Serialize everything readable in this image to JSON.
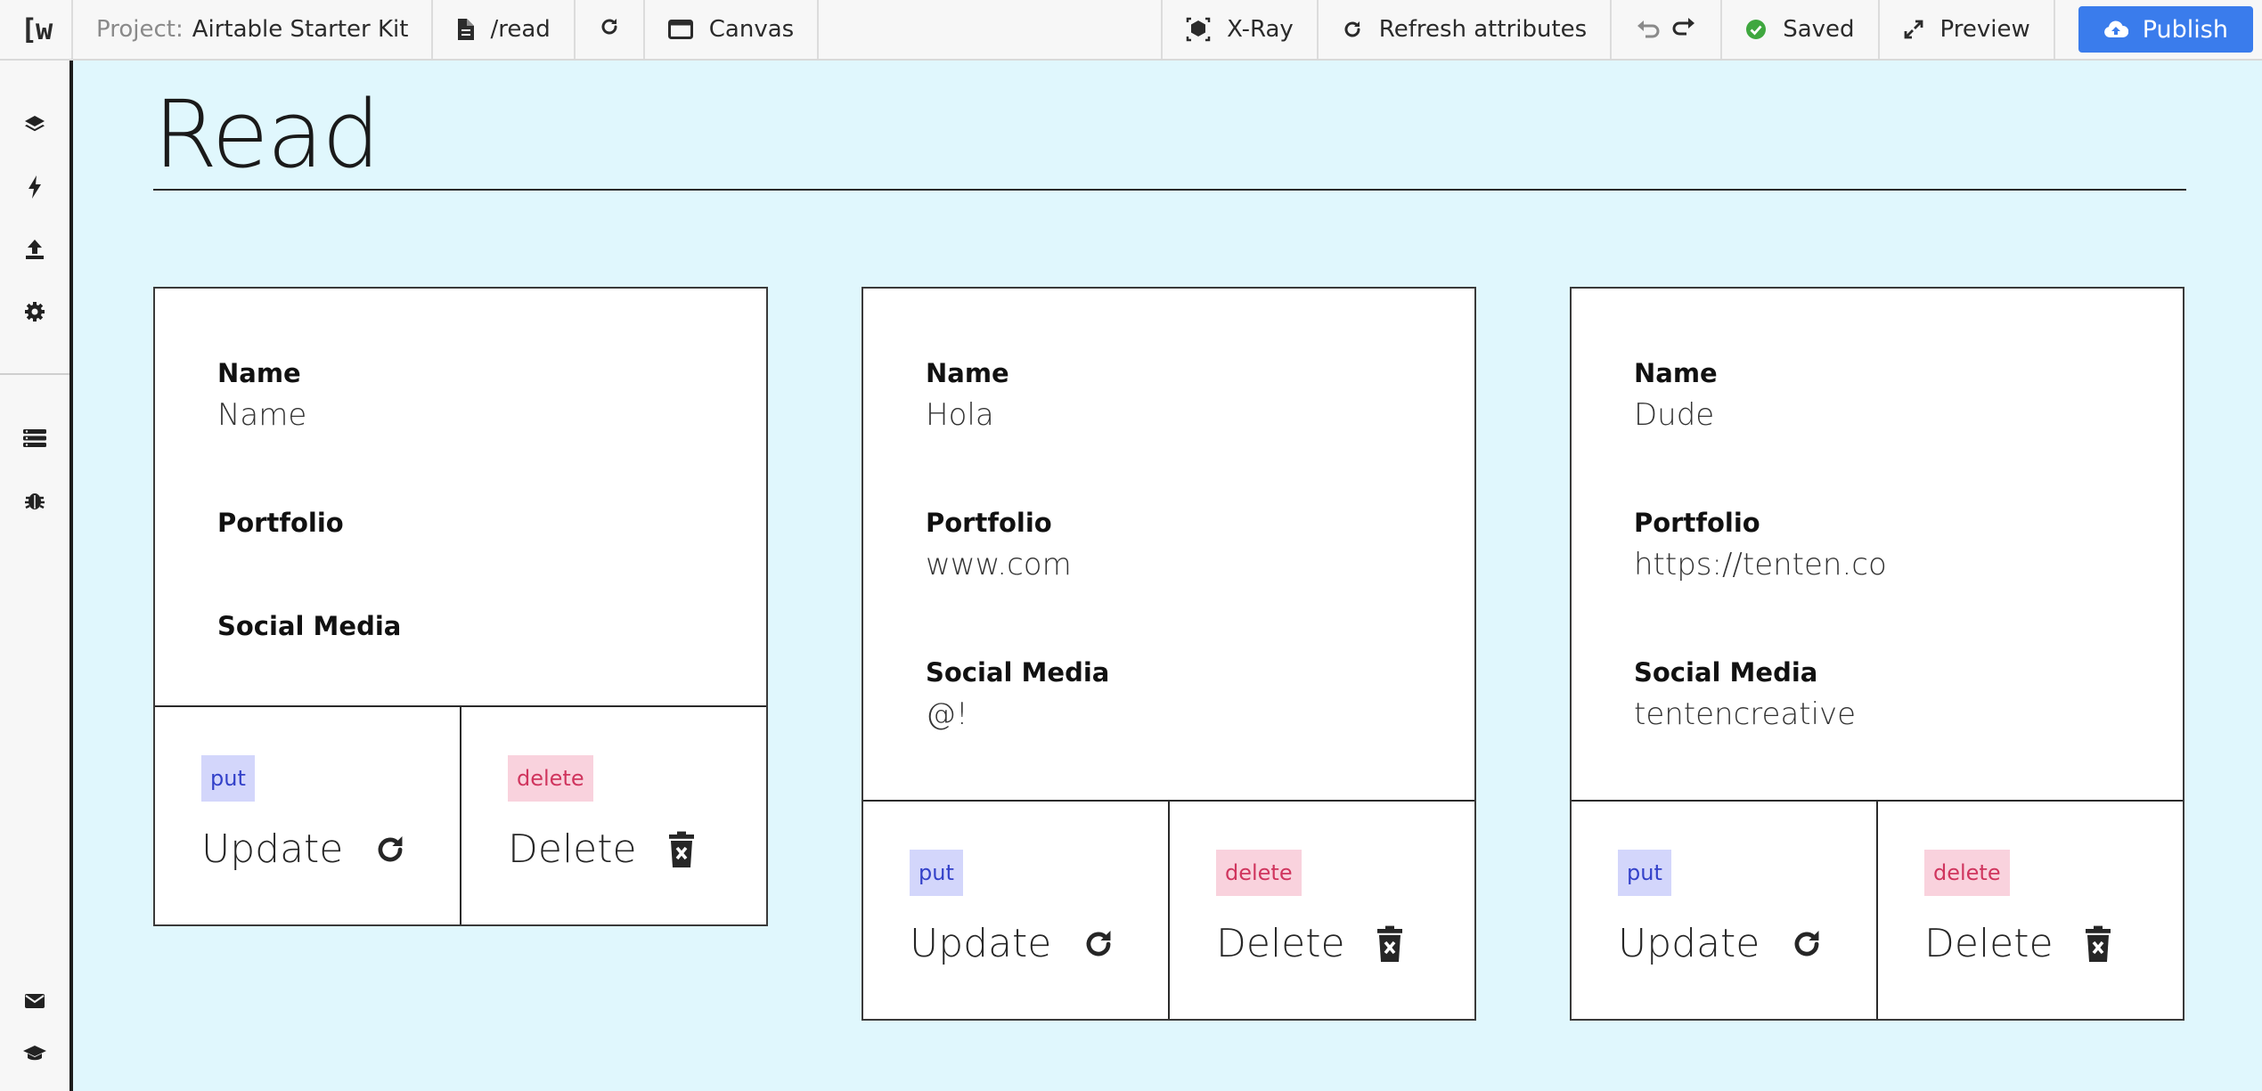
{
  "toolbar": {
    "logo": "[w",
    "project_key": "Project:",
    "project_name": "Airtable Starter Kit",
    "page_path": "/read",
    "canvas_label": "Canvas",
    "xray_label": "X-Ray",
    "refresh_label": "Refresh attributes",
    "saved_label": "Saved",
    "preview_label": "Preview",
    "publish_label": "Publish"
  },
  "page": {
    "title": "Read"
  },
  "records": [
    {
      "fields": [
        {
          "label": "Name",
          "value": "Name"
        },
        {
          "label": "Portfolio",
          "value": ""
        },
        {
          "label": "Social Media",
          "value": ""
        }
      ],
      "put_tag": "put",
      "update_label": "Update",
      "delete_tag": "delete",
      "delete_label": "Delete"
    },
    {
      "fields": [
        {
          "label": "Name",
          "value": "Hola"
        },
        {
          "label": "Portfolio",
          "value": "www.com"
        },
        {
          "label": "Social Media",
          "value": "@!"
        }
      ],
      "put_tag": "put",
      "update_label": "Update",
      "delete_tag": "delete",
      "delete_label": "Delete"
    },
    {
      "fields": [
        {
          "label": "Name",
          "value": "Dude"
        },
        {
          "label": "Portfolio",
          "value": "https://tenten.co"
        },
        {
          "label": "Social Media",
          "value": "tentencreative"
        }
      ],
      "put_tag": "put",
      "update_label": "Update",
      "delete_tag": "delete",
      "delete_label": "Delete"
    }
  ],
  "colors": {
    "canvas_bg": "#e0f7fd",
    "publish_bg": "#3a7cec",
    "saved_check": "#3fa73f",
    "put_tag_bg": "#d3d6fb",
    "put_tag_text": "#3341c9",
    "delete_tag_bg": "#f9d2dd",
    "delete_tag_text": "#d0355e"
  }
}
